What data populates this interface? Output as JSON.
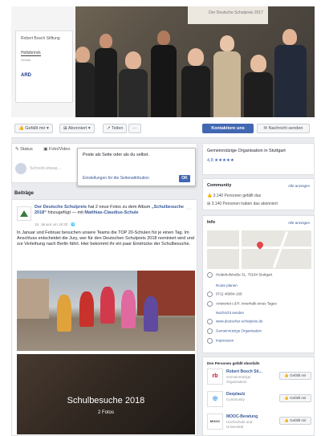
{
  "cover": {
    "logos": {
      "rbs": "Robert Bosch Stiftung",
      "holtzbrinck": "Holtzbrinck",
      "holtzbrinck_sub": "Schule",
      "ard": "ARD"
    },
    "banner": "Der Deutsche Schulpreis 2017"
  },
  "actions": {
    "liked": "Gefällt mir",
    "subscribed": "Abonniert",
    "share": "Teilen",
    "more": "···",
    "contact": "Kontaktiere uns",
    "message": "Nachricht senden"
  },
  "composer": {
    "tab_status": "Status",
    "tab_photo": "Foto/Video",
    "placeholder": "Schreib etwas...",
    "popup_title": "Poste als Seite oder als du selbst.",
    "popup_link": "Einstellungen für die Seitenattribution",
    "popup_ok": "OK"
  },
  "feed": {
    "section_title": "Beiträge",
    "post": {
      "page_name": "Der Deutsche Schulpreis",
      "action": "hat 2 neue Fotos zu dem Album",
      "album": "„Schulbesuche 2018“",
      "hinzugefuegt": "hinzugefügt — mit",
      "tagged": "Matthias-Claudius-Schule",
      "time": "16. Januar um 16:30 · 🌐",
      "text": "In Januar und Februar besuchen unsere Teams die TOP 20-Schulen für je einen Tag. Im Anschluss entscheidet die Jury, wer für den Deutschen Schulpreis 2018 nominiert wird und zur Verleihung nach Berlin fährt. Hier bekommt ihr ein paar Eindrücke der Schulbesuche.",
      "album_title": "Schulbesuche 2018",
      "album_count": "2 Fotos"
    }
  },
  "sidebar": {
    "about_text": "Gemeinnützige Organisation in Stuttgart",
    "rating": "4,8 ★★★★★",
    "community": {
      "title": "Community",
      "link": "Alle anzeigen",
      "likes": "3.140 Personen gefällt das",
      "follows": "3.140 Personen haben das abonniert"
    },
    "info": {
      "title": "Info",
      "link": "Alle anzeigen",
      "address": "Heidehofstraße 31, 70184 Stuttgart",
      "route": "Route planen",
      "phone": "0711 46084-169",
      "reply": "Antwortet i.d.R. innerhalb eines Tages",
      "send": "Nachricht senden",
      "website": "www.deutscher-schulpreis.de",
      "category": "Gemeinnützige Organisation",
      "imprint": "Impressum"
    },
    "likes_section": {
      "title": "Den Personen gefällt ebenfalls",
      "items": [
        {
          "name": "Robert Bosch Sti...",
          "sub": "Gemeinnützige Organisation",
          "logo": "rb",
          "button": "Gefällt mir"
        },
        {
          "name": "Deeplaulz",
          "sub": "Community",
          "logo": "◎",
          "button": "Gefällt mir"
        },
        {
          "name": "MOOC-Beratung",
          "sub": "Hochschule und Universität",
          "logo": "MOOC",
          "button": "Gefällt mir"
        }
      ]
    }
  },
  "colors": {
    "facebook_blue": "#4267b2",
    "link_blue": "#385898",
    "background": "#e9ebee"
  }
}
